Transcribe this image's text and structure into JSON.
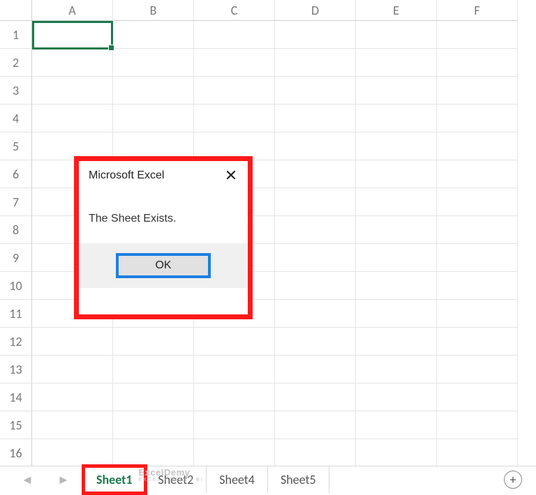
{
  "columns": [
    "A",
    "B",
    "C",
    "D",
    "E",
    "F"
  ],
  "rows": [
    "1",
    "2",
    "3",
    "4",
    "5",
    "6",
    "7",
    "8",
    "9",
    "10",
    "11",
    "12",
    "13",
    "14",
    "15",
    "16"
  ],
  "dialog": {
    "title": "Microsoft Excel",
    "close_glyph": "✕",
    "message": "The Sheet Exists.",
    "ok_label": "OK"
  },
  "sheetbar": {
    "nav_prev": "◄",
    "nav_next": "►",
    "tabs": [
      {
        "label": "Sheet1",
        "active": true
      },
      {
        "label": "Sheet2",
        "active": false
      },
      {
        "label": "Sheet4",
        "active": false
      },
      {
        "label": "Sheet5",
        "active": false
      }
    ],
    "add_glyph": "+"
  },
  "watermark": {
    "top": "ExcelDemy",
    "bot": "EXCEL • DATA • BI"
  }
}
